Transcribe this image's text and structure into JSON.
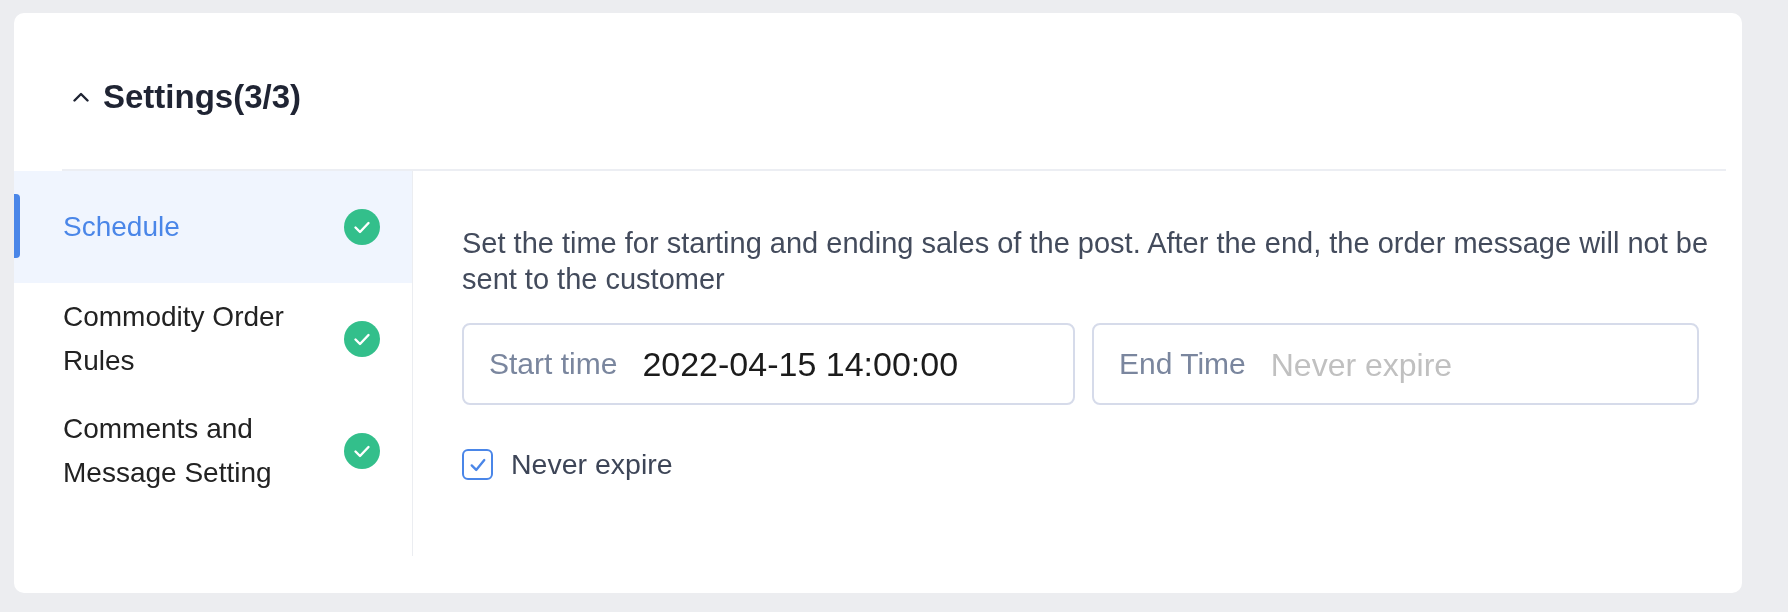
{
  "section": {
    "title": "Settings(3/3)",
    "expanded": true
  },
  "nav": [
    {
      "label": "Schedule",
      "selected": true,
      "done": true
    },
    {
      "label": "Commodity Order Rules",
      "selected": false,
      "done": true
    },
    {
      "label": "Comments and Message Setting",
      "selected": false,
      "done": true
    }
  ],
  "schedule": {
    "description": "Set the time for starting and ending sales of the post. After the end, the order message will not be sent to the customer",
    "fields": [
      {
        "label": "Start time",
        "value": "2022-04-15 14:00:00"
      },
      {
        "label": "End Time",
        "placeholder": "Never expire"
      }
    ],
    "never_expire": {
      "label": "Never expire",
      "checked": true
    }
  }
}
